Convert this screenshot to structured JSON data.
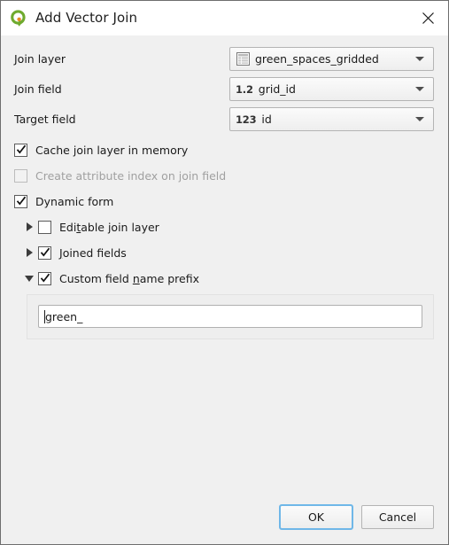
{
  "window": {
    "title": "Add Vector Join",
    "logo_icon": "qgis-logo-icon",
    "close_icon": "close-icon"
  },
  "form": {
    "rows": [
      {
        "label": "Join layer",
        "icon": "vector-table-icon",
        "icon_kind": "grid",
        "value": "green_spaces_gridded",
        "arrow_icon": "chevron-down-icon"
      },
      {
        "label": "Join field",
        "icon": "decimal-field-icon",
        "icon_kind": "text",
        "icon_text": "1.2",
        "value": "grid_id",
        "arrow_icon": "chevron-down-icon"
      },
      {
        "label": "Target field",
        "icon": "integer-field-icon",
        "icon_kind": "text",
        "icon_text": "123",
        "value": "id",
        "arrow_icon": "chevron-down-icon"
      }
    ]
  },
  "options": {
    "cache_join_layer": {
      "label": "Cache join layer in memory",
      "checked": true,
      "enabled": true
    },
    "create_attribute_index": {
      "label": "Create attribute index on join field",
      "checked": false,
      "enabled": false
    },
    "dynamic_form": {
      "label": "Dynamic form",
      "checked": true,
      "enabled": true
    },
    "editable_join_layer": {
      "label_before": "Edi",
      "label_mnemonic": "t",
      "label_after": "able join layer",
      "checked": false,
      "enabled": true,
      "expander_icon": "triangle-right-icon",
      "expanded": false
    },
    "joined_fields": {
      "label_before": "",
      "label_mnemonic": "J",
      "label_after": "oined fields",
      "checked": true,
      "enabled": true,
      "expander_icon": "triangle-right-icon",
      "expanded": false
    },
    "custom_field_name_prefix": {
      "label_before": "Custom field ",
      "label_mnemonic": "n",
      "label_after": "ame prefix",
      "checked": true,
      "enabled": true,
      "expander_icon": "triangle-down-icon",
      "expanded": true
    }
  },
  "prefix_input": {
    "value": "green_",
    "placeholder": ""
  },
  "buttons": {
    "ok": "OK",
    "cancel": "Cancel"
  },
  "colors": {
    "dialog_background": "#f0f0f0",
    "titlebar_background": "#ffffff",
    "border": "#6e6e6e",
    "focus_ring": "#6fb7e8",
    "logo_green": "#6faa2e",
    "logo_orange": "#e88b22",
    "disabled_text": "#a0a0a0",
    "text": "#1a1a1a"
  }
}
